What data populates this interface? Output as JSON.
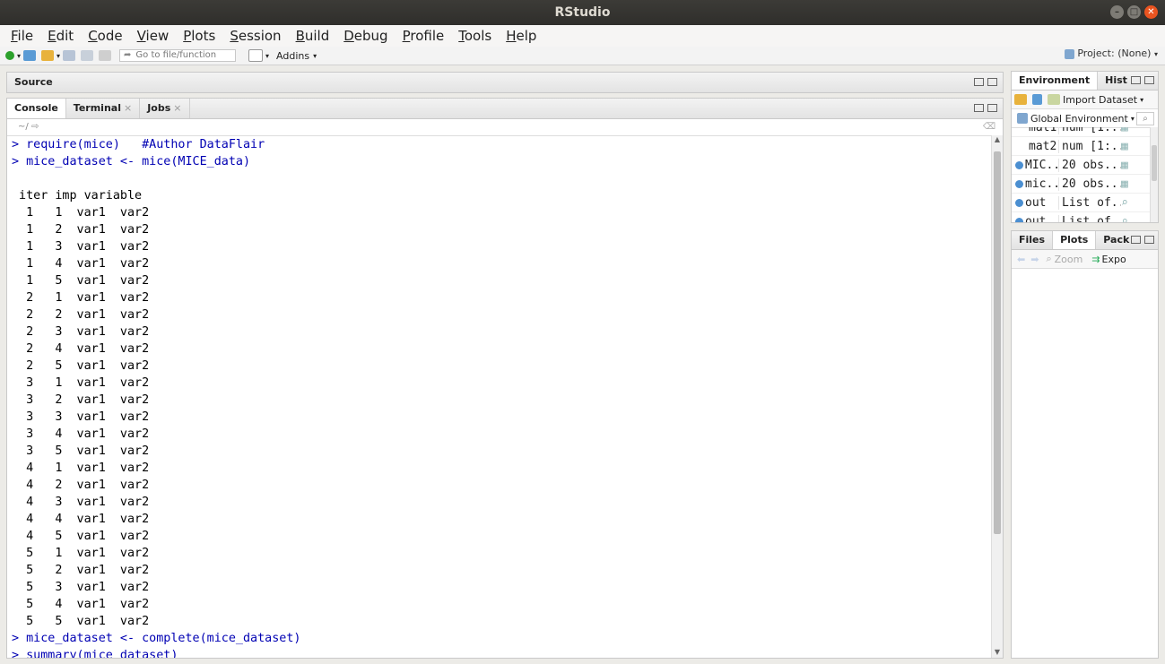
{
  "window": {
    "title": "RStudio"
  },
  "menu": [
    "File",
    "Edit",
    "Code",
    "View",
    "Plots",
    "Session",
    "Build",
    "Debug",
    "Profile",
    "Tools",
    "Help"
  ],
  "toolbar": {
    "goto_placeholder": "Go to file/function",
    "addins": "Addins",
    "project": "Project: (None)"
  },
  "source_pane": {
    "title": "Source"
  },
  "console_pane": {
    "tabs": [
      "Console",
      "Terminal",
      "Jobs"
    ],
    "path": "~/",
    "lines": [
      {
        "prompt": true,
        "text": "> require(mice)   #Author DataFlair"
      },
      {
        "prompt": true,
        "text": "> mice_dataset <- mice(MICE_data)"
      },
      {
        "prompt": false,
        "text": ""
      },
      {
        "prompt": false,
        "text": " iter imp variable"
      },
      {
        "prompt": false,
        "text": "  1   1  var1  var2"
      },
      {
        "prompt": false,
        "text": "  1   2  var1  var2"
      },
      {
        "prompt": false,
        "text": "  1   3  var1  var2"
      },
      {
        "prompt": false,
        "text": "  1   4  var1  var2"
      },
      {
        "prompt": false,
        "text": "  1   5  var1  var2"
      },
      {
        "prompt": false,
        "text": "  2   1  var1  var2"
      },
      {
        "prompt": false,
        "text": "  2   2  var1  var2"
      },
      {
        "prompt": false,
        "text": "  2   3  var1  var2"
      },
      {
        "prompt": false,
        "text": "  2   4  var1  var2"
      },
      {
        "prompt": false,
        "text": "  2   5  var1  var2"
      },
      {
        "prompt": false,
        "text": "  3   1  var1  var2"
      },
      {
        "prompt": false,
        "text": "  3   2  var1  var2"
      },
      {
        "prompt": false,
        "text": "  3   3  var1  var2"
      },
      {
        "prompt": false,
        "text": "  3   4  var1  var2"
      },
      {
        "prompt": false,
        "text": "  3   5  var1  var2"
      },
      {
        "prompt": false,
        "text": "  4   1  var1  var2"
      },
      {
        "prompt": false,
        "text": "  4   2  var1  var2"
      },
      {
        "prompt": false,
        "text": "  4   3  var1  var2"
      },
      {
        "prompt": false,
        "text": "  4   4  var1  var2"
      },
      {
        "prompt": false,
        "text": "  4   5  var1  var2"
      },
      {
        "prompt": false,
        "text": "  5   1  var1  var2"
      },
      {
        "prompt": false,
        "text": "  5   2  var1  var2"
      },
      {
        "prompt": false,
        "text": "  5   3  var1  var2"
      },
      {
        "prompt": false,
        "text": "  5   4  var1  var2"
      },
      {
        "prompt": false,
        "text": "  5   5  var1  var2"
      },
      {
        "prompt": true,
        "text": "> mice_dataset <- complete(mice_dataset)"
      },
      {
        "prompt": true,
        "text": "> summary(mice_dataset)"
      }
    ]
  },
  "env_pane": {
    "tabs": [
      "Environment",
      "Hist"
    ],
    "import_label": "Import Dataset",
    "scope": "Global Environment",
    "rows": [
      {
        "name": "mat1",
        "value": "num [1:...",
        "icon": "none"
      },
      {
        "name": "mat2",
        "value": "num [1:...",
        "icon": "none"
      },
      {
        "name": "MIC...",
        "value": "20 obs....",
        "icon": "expand"
      },
      {
        "name": "mic...",
        "value": "20 obs....",
        "icon": "expand"
      },
      {
        "name": "out",
        "value": "List of...",
        "icon": "expand"
      },
      {
        "name": "out",
        "value": "List of",
        "icon": "expand"
      }
    ]
  },
  "files_pane": {
    "tabs": [
      "Files",
      "Plots",
      "Pack"
    ],
    "zoom": "Zoom",
    "export": "Expo"
  }
}
